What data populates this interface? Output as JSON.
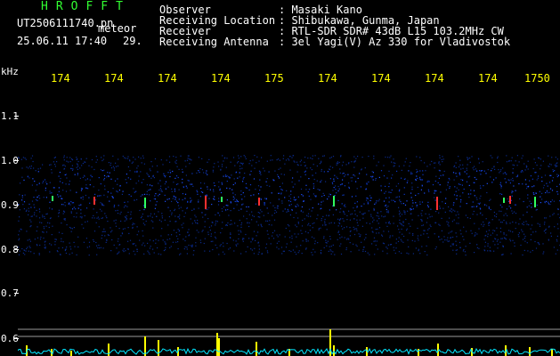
{
  "header": {
    "brand": "HROFFT",
    "filename": "UT2506111740.pn",
    "filename_suffix": "meteor",
    "timestamp": "25.06.11 17:40",
    "count": "29."
  },
  "meta": {
    "rows": [
      {
        "key": "Observer",
        "value": ": Masaki Kano"
      },
      {
        "key": "Receiving Location",
        "value": ": Shibukawa, Gunma, Japan"
      },
      {
        "key": "Receiver",
        "value": ": RTL-SDR SDR# 43dB L15 103.2MHz CW"
      },
      {
        "key": "Receiving Antenna",
        "value": ": 3el Yagi(V) Az 330 for Vladivostok"
      }
    ]
  },
  "spectrogram": {
    "y_unit": "kHz",
    "x_ticks": [
      "174",
      "174",
      "174",
      "174",
      "175",
      "174",
      "174",
      "174",
      "174",
      "1750"
    ],
    "y_ticks": [
      "1.1",
      "1.0",
      "0.9",
      "0.8",
      "0.7",
      "0.6"
    ],
    "y_range": [
      0.6,
      1.15
    ],
    "band_kHz": [
      0.8,
      1.0
    ],
    "colors": {
      "background": "#000000",
      "noise_low": "#0a2a8a",
      "noise_mid": "#1e50ff",
      "echo": "#ff3030",
      "echo_alt": "#30ff60",
      "trace": "#00e6ff",
      "spike": "#ffff00"
    }
  }
}
